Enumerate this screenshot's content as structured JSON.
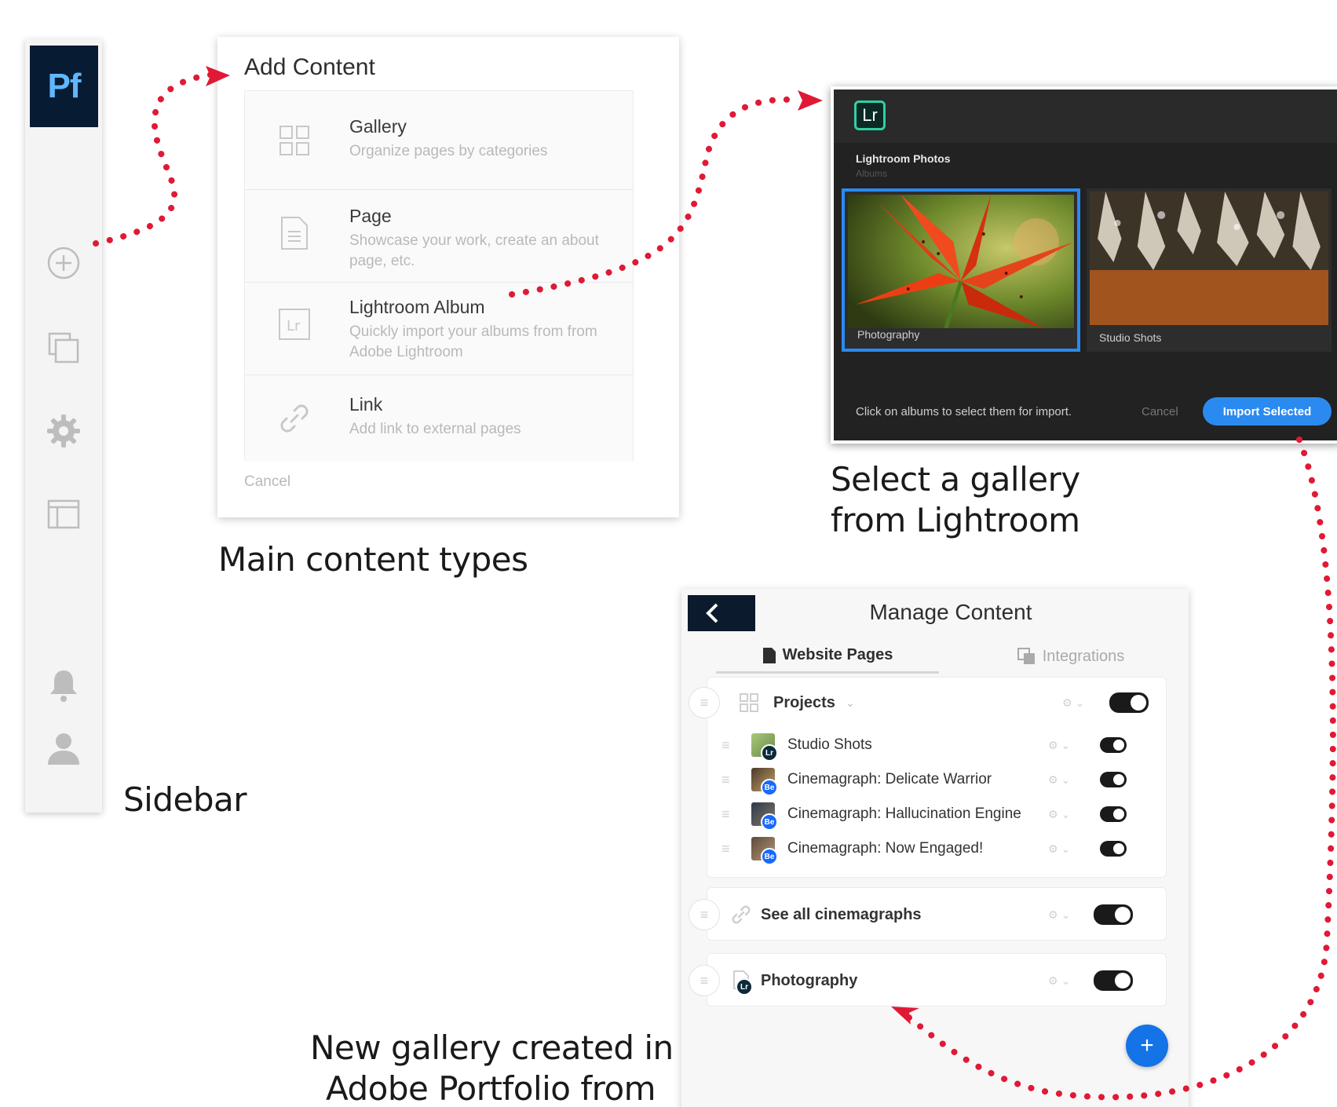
{
  "colors": {
    "pf_brand": "#071b33",
    "pf_text": "#5fb7ff",
    "lr_accent": "#31d0a3",
    "primary_blue": "#2b8af0",
    "arrow_red": "#e01935"
  },
  "sidebar": {
    "logo": "Pf",
    "icons": [
      "plus-circle-icon",
      "pages-icon",
      "gear-icon",
      "layout-icon",
      "bell-icon",
      "user-icon"
    ]
  },
  "captions": {
    "sidebar": "Sidebar",
    "main_types": "Main content types",
    "select_gallery_1": "Select a gallery",
    "select_gallery_2": "from Lightroom",
    "new_gallery_1": "New gallery created in",
    "new_gallery_2": "Adobe Portfolio from"
  },
  "add_content": {
    "title": "Add Content",
    "items": [
      {
        "title": "Gallery",
        "desc": "Organize pages by categories",
        "icon": "grid-icon"
      },
      {
        "title": "Page",
        "desc": "Showcase your work, create an about page, etc.",
        "icon": "page-icon"
      },
      {
        "title": "Lightroom Album",
        "desc": "Quickly import your albums from from Adobe Lightroom",
        "icon": "lightroom-icon"
      },
      {
        "title": "Link",
        "desc": "Add link to external pages",
        "icon": "link-icon"
      }
    ],
    "cancel": "Cancel"
  },
  "lightroom": {
    "logo": "Lr",
    "title": "Lightroom Photos",
    "subtitle": "Albums",
    "albums": [
      {
        "label": "Photography",
        "selected": true
      },
      {
        "label": "Studio Shots",
        "selected": false
      }
    ],
    "footer_text": "Click on albums to select them for import.",
    "cancel": "Cancel",
    "import": "Import Selected"
  },
  "manage": {
    "title": "Manage Content",
    "tabs": [
      {
        "label": "Website Pages",
        "active": true
      },
      {
        "label": "Integrations",
        "active": false
      }
    ],
    "projects": {
      "label": "Projects",
      "items": [
        {
          "label": "Studio Shots",
          "badge": "Lr"
        },
        {
          "label": "Cinemagraph: Delicate Warrior",
          "badge": "Be"
        },
        {
          "label": "Cinemagraph: Hallucination Engine",
          "badge": "Be"
        },
        {
          "label": "Cinemagraph: Now Engaged!",
          "badge": "Be"
        }
      ]
    },
    "link_row": "See all cinemagraphs",
    "photo_row": "Photography",
    "add_button": "+"
  }
}
